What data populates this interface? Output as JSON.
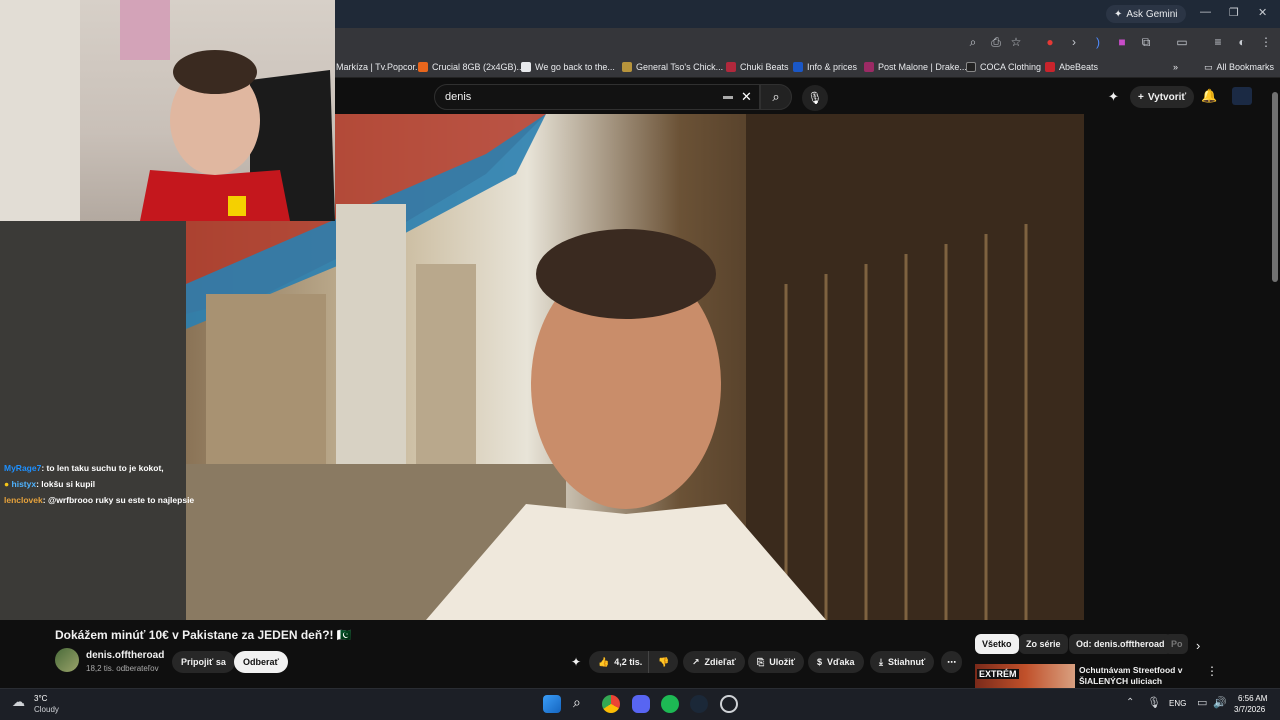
{
  "browser": {
    "ask_gemini_label": "Ask Gemini",
    "bookmarks": [
      {
        "label": "Markíza | Tv.Popcor...",
        "color": "#d9342b"
      },
      {
        "label": "Crucial 8GB (2x4GB)...",
        "color": "#e8661c"
      },
      {
        "label": "We go back to the...",
        "color": "#e8eaed"
      },
      {
        "label": "General Tso's Chick...",
        "color": "#b7943c"
      },
      {
        "label": "Chuki Beats",
        "color": "#b1283c"
      },
      {
        "label": "Info & prices",
        "color": "#1a57c6"
      },
      {
        "label": "Post Malone | Drake...",
        "color": "#9b2a64"
      },
      {
        "label": "COCA Clothing",
        "color": "#222222"
      },
      {
        "label": "AbeBeats",
        "color": "#c9242c"
      }
    ],
    "all_bookmarks_label": "All Bookmarks"
  },
  "youtube": {
    "search_query": "denis",
    "create_label": "Vytvoriť",
    "video_title": "Dokážem minúť 10€ v Pakistane za JEDEN deň?! 🇵🇰",
    "channel_name": "denis.offtheroad",
    "channel_subs": "18,2 tis. odberateľov",
    "join_label": "Pripojiť sa",
    "subscribe_label": "Odberať",
    "like_count": "4,2 tis.",
    "share_label": "Zdieľať",
    "save_label": "Uložiť",
    "thanks_label": "Vďaka",
    "download_label": "Stiahnuť",
    "chips": [
      "Všetko",
      "Zo série",
      "Od: denis.offtheroad",
      "Po"
    ],
    "reco_title": "Ochutnávam Streetfood v ŠIALENÝCH uliciach Pakistan...",
    "reco_thumb_text": "EXTRÉM"
  },
  "chat": {
    "messages": [
      {
        "user": "MyRage7",
        "user_color": "#1e90ff",
        "text": ": to len taku suchu to je kokot,"
      },
      {
        "user": "histyx",
        "user_color": "#4fb3ff",
        "text": ": lokšu si kupil"
      },
      {
        "user": "lenclovek",
        "user_color": "#e6a23c",
        "text": ": @wrfbrooo ruky su este to najlepsie"
      }
    ]
  },
  "taskbar": {
    "weather_temp": "3°C",
    "weather_desc": "Cloudy",
    "lang": "ENG",
    "time": "6:56 AM",
    "date": "3/7/2026"
  }
}
